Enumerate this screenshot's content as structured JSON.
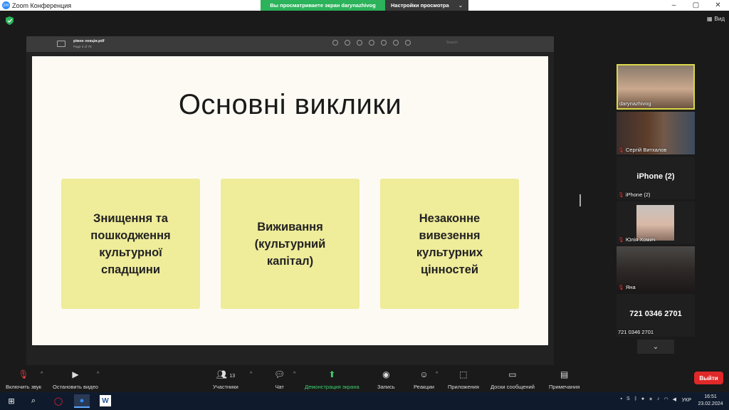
{
  "window": {
    "title": "Zoom Конференция",
    "logo_text": "zm",
    "controls": [
      "–",
      "▢",
      "✕"
    ]
  },
  "share_banner": {
    "viewing": "Вы просматриваете экран darynazhivog",
    "options": "Настройки просмотра"
  },
  "view_button": "Вид",
  "pdf": {
    "filename": "рівне лекція.pdf",
    "page": "Page 3 of 79",
    "search_placeholder": "Search"
  },
  "slide": {
    "title": "Основні виклики",
    "cards": [
      "Знищення та пошкодження культурної спадщини",
      "Виживання (культурний капітал)",
      "Незаконне вивезення культурних цінностей"
    ]
  },
  "participants": [
    {
      "name": "darynazhivog",
      "muted": false
    },
    {
      "name": "Сергій Витхалов",
      "muted": true
    },
    {
      "name": "iPhone (2)",
      "display": "iPhone (2)",
      "muted": true
    },
    {
      "name": "Юлія Хомич",
      "muted": true
    },
    {
      "name": "Яна",
      "muted": true
    },
    {
      "name": "721 0346 2701",
      "display": "721 0346 2701",
      "muted": false
    }
  ],
  "toolbar": {
    "unmute": "Включить звук",
    "stop_video": "Остановить видео",
    "participants": "Участники",
    "participants_count": "13",
    "chat": "Чат",
    "share_screen": "Демонстрация экрана",
    "record": "Запись",
    "reactions": "Реакции",
    "apps": "Приложения",
    "whiteboards": "Доски сообщений",
    "notes": "Примечания",
    "leave": "Выйти"
  },
  "taskbar": {
    "language": "УКР",
    "time": "16:51",
    "date": "23.02.2024"
  },
  "colors": {
    "share_green": "#2bb25a",
    "card_yellow": "#efec9a",
    "leave_red": "#e02828",
    "active_speaker": "#d8d84a"
  }
}
